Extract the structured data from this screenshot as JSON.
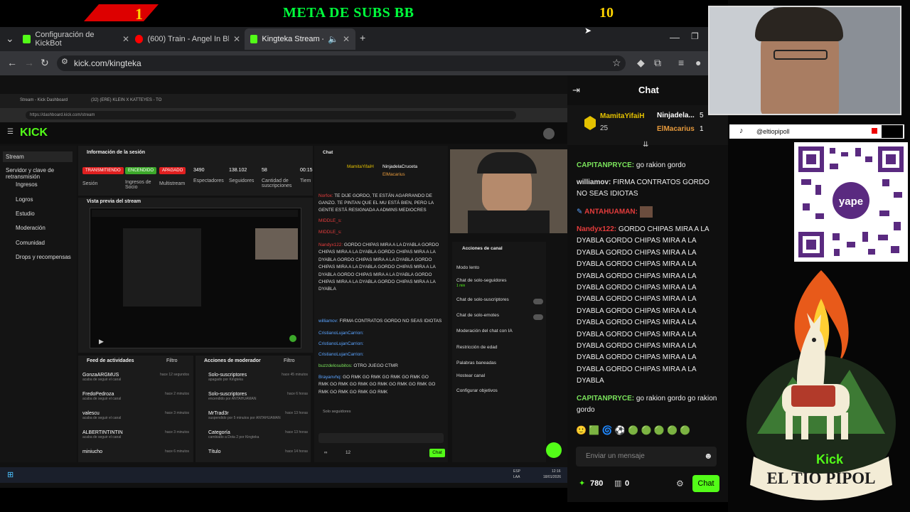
{
  "banner": {
    "num_left": "1",
    "title": "META DE SUBS BB",
    "num_right": "10"
  },
  "browser": {
    "tabs": [
      {
        "label": "Configuración de KickBot",
        "color": "#53fc18"
      },
      {
        "label": "(600) Train - Angel In Blue Jean",
        "color": "#ff0000"
      },
      {
        "label": "Kingteka Stream - Watch Li",
        "color": "#53fc18"
      }
    ],
    "url": "kick.com/kingteka"
  },
  "dashboard": {
    "inner_tabs": [
      "Stream - Kick Dashboard",
      "(32) (ERE) KLEIN X KATTEYES - TO"
    ],
    "inner_url": "https://dashboard.kick.com/stream",
    "logo": "KICK",
    "sidebar": [
      "Stream",
      "Servidor y clave de retransmisión",
      "Ingresos",
      "Logros",
      "Estudio",
      "Moderación",
      "Comunidad",
      "Drops y recompensas"
    ],
    "session": {
      "title": "Información de la sesión",
      "pills": [
        "TRANSMITIENDO",
        "ENCENDIDO",
        "APAGADO"
      ],
      "stats": [
        {
          "v": "3490",
          "l": "Espectadores"
        },
        {
          "v": "138.102",
          "l": "Seguidores"
        },
        {
          "v": "58",
          "l": "Cantidad de suscripciones"
        },
        {
          "v": "00:15",
          "l": "Tiem"
        }
      ],
      "labels": [
        "Sesión",
        "Ingresos de Socio",
        "Multistream"
      ]
    },
    "preview_title": "Vista previa del stream",
    "feed": {
      "title": "Feed de actividades",
      "filter": "Filtro",
      "rows": [
        {
          "user": "GonzaARGMUS",
          "act": "acaba de seguir el canal",
          "t": "hace 12 segundos"
        },
        {
          "user": "FredoPedroza",
          "act": "acaba de seguir el canal",
          "t": "hace 2 minutos"
        },
        {
          "user": "valescu",
          "act": "acaba de seguir el canal",
          "t": "hace 3 minutos"
        },
        {
          "user": "ALBERTINTINTIN",
          "act": "acaba de seguir el canal",
          "t": "hace 3 minutos"
        },
        {
          "user": "miniucho",
          "act": "acaba de seguir el canal",
          "t": "hace 6 minutos"
        }
      ]
    },
    "mods": {
      "title": "Acciones de moderador",
      "filter": "Filtro",
      "rows": [
        {
          "title": "Solo-suscriptores",
          "sub": "apagado por Kingteka",
          "t": "hace 45 minutos"
        },
        {
          "title": "Solo-suscriptores",
          "sub": "encendido por ANTAHUAMAN",
          "t": "hace 6 horas"
        },
        {
          "title": "MrTrad3r",
          "sub": "suspendido por 5 minutos por ANTAHUAMAN",
          "t": "hace 13 horas"
        },
        {
          "title": "Categoría",
          "sub": "cambiado a Dota 2 por Kingteka",
          "t": "hace 13 horas"
        },
        {
          "title": "Título",
          "sub": "",
          "t": "hace 14 horas"
        }
      ]
    },
    "small_chat": {
      "title": "Chat",
      "top": [
        "MamitaYifaiH",
        "NinjadelaCruceta",
        "ElMacarius"
      ],
      "lines": [
        {
          "u": "Norfox:",
          "t": "TE DIJE GORDO, TE ESTÁN AGARRANDO DE GANZO. TE PINTAN QUE EL MU ESTÁ BIEN, PERO LA GENTE ESTÁ RESIGNADA A ADMINS MEDIOCRES"
        },
        {
          "u": "MIDDLE_s:",
          "t": ""
        },
        {
          "u": "MIDDLE_s:",
          "t": ""
        },
        {
          "u": "Nandyx122:",
          "t": "GORDO CHIPAS MIRA A LA DYABLA GORDO CHIPAS MIRA A LA DYABLA GORDO CHIPAS MIRA A LA DYABLA GORDO CHIPAS MIRA A LA DYABLA GORDO CHIPAS MIRA A LA DYABLA GORDO CHIPAS MIRA A LA DYABLA GORDO CHIPAS MIRA A LA DYABLA GORDO CHIPAS MIRA A LA DYABLA GORDO CHIPAS MIRA A LA DYABLA"
        },
        {
          "u": "williamov:",
          "t": "FIRMA CONTRATOS GORDO  NO SEAS IDIOTAS"
        },
        {
          "u": "CristianoLujanCarrion:",
          "t": ""
        },
        {
          "u": "CristianoLujanCarrion:",
          "t": ""
        },
        {
          "u": "CristianoLujanCarrion:",
          "t": ""
        },
        {
          "u": "buzzdelosubitos:",
          "t": "OTRO JUEGO CTMR"
        },
        {
          "u": "Brayanvhq:",
          "t": "GO RMK GO RMK GO RMK GO RMK GO RMK GO RMK GO RMK GO RMK GO RMK GO RMK GO RMK GO RMK GO RMK GO RMK"
        }
      ],
      "mode": "Solo seguidores",
      "counts": [
        "∞",
        "12"
      ],
      "chat_btn": "Chat"
    },
    "actions": {
      "title": "Acciones de canal",
      "items": [
        "Modo lento",
        "Chat de solo-seguidores",
        "Chat de solo-suscriptores",
        "Chat de solo-emotes",
        "Moderación del chat con IA",
        "Restricción de edad",
        "Palabras baneadas",
        "Hostear canal",
        "Configurar objetivos"
      ],
      "sub": "1 min"
    },
    "clock": [
      "12:16",
      "18/01/2026"
    ],
    "lang": [
      "ESP",
      "LAA"
    ]
  },
  "chat": {
    "title": "Chat",
    "top_gifter": {
      "name": "MamitaYifaiH",
      "count": "25"
    },
    "gifter2": {
      "name": "Ninjadela...",
      "count": "5"
    },
    "gifter3": {
      "name": "ElMacarius",
      "count": "1"
    },
    "messages": [
      {
        "user": "CAPITANPRYCE:",
        "color": "#7ae35b",
        "text": "go rakion gordo"
      },
      {
        "user": "williamov:",
        "color": "#dddddd",
        "text": "FIRMA CONTRATOS GORDO  NO SEAS IDIOTAS"
      },
      {
        "user": "ANTAHUAMAN:",
        "color": "#e63c3c",
        "text": ""
      },
      {
        "user": "Nandyx122:",
        "color": "#e63c3c",
        "text": "GORDO CHIPAS MIRA A LA DYABLA GORDO CHIPAS MIRA A LA DYABLA GORDO CHIPAS MIRA A LA DYABLA GORDO CHIPAS MIRA A LA DYABLA GORDO CHIPAS MIRA A LA DYABLA GORDO CHIPAS MIRA A LA DYABLA GORDO CHIPAS MIRA A LA DYABLA GORDO CHIPAS MIRA A LA DYABLA GORDO CHIPAS MIRA A LA DYABLA GORDO CHIPAS MIRA A LA DYABLA GORDO CHIPAS MIRA A LA DYABLA GORDO CHIPAS MIRA A LA DYABLA GORDO CHIPAS MIRA A LA DYABLA"
      },
      {
        "user": "CAPITANPRYCE:",
        "color": "#7ae35b",
        "text": "go rakion gordo go rakion gordo"
      }
    ],
    "input_placeholder": "Enviar un mensaje",
    "points": "780",
    "zero": "0",
    "send": "Chat"
  },
  "overlay": {
    "tiktok": "@eltiopipoll",
    "qr_label": "yape",
    "llama_text": "EL TIO PIPOL",
    "llama_kick": "Kick"
  }
}
